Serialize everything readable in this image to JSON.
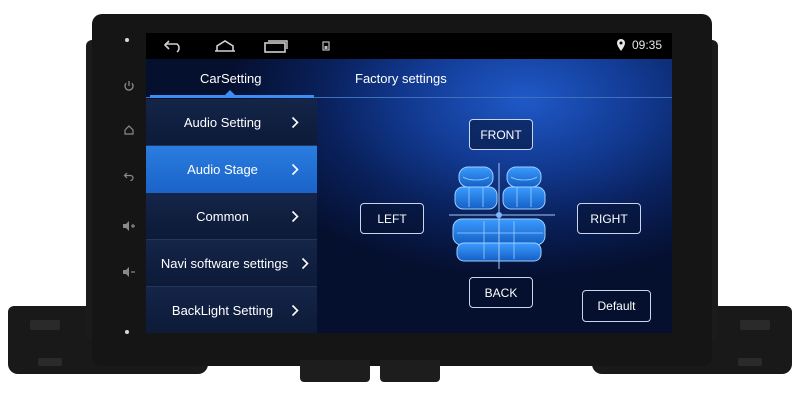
{
  "status_bar": {
    "time": "09:35",
    "icons": [
      "back-arrow-icon",
      "home-icon",
      "recent-apps-icon",
      "notification-icon",
      "location-pin-icon"
    ]
  },
  "tabs": [
    {
      "label": "CarSetting",
      "active": true
    },
    {
      "label": "Factory settings",
      "active": false
    }
  ],
  "menu": {
    "items": [
      {
        "label": "Audio Setting",
        "active": false
      },
      {
        "label": "Audio Stage",
        "active": true
      },
      {
        "label": "Common",
        "active": false
      },
      {
        "label": "Navi software settings",
        "active": false
      },
      {
        "label": "BackLight Setting",
        "active": false
      }
    ],
    "chevron_icon": "chevron-right-icon"
  },
  "stage": {
    "front_label": "FRONT",
    "back_label": "BACK",
    "left_label": "LEFT",
    "right_label": "RIGHT",
    "default_label": "Default",
    "seat_icon": "car-seats-icon"
  },
  "colors": {
    "active_item": "#2372d8",
    "accent_line": "#3e8df0",
    "seat_fill": "#1f7ad8",
    "screen_bg": "#0b2a78"
  }
}
